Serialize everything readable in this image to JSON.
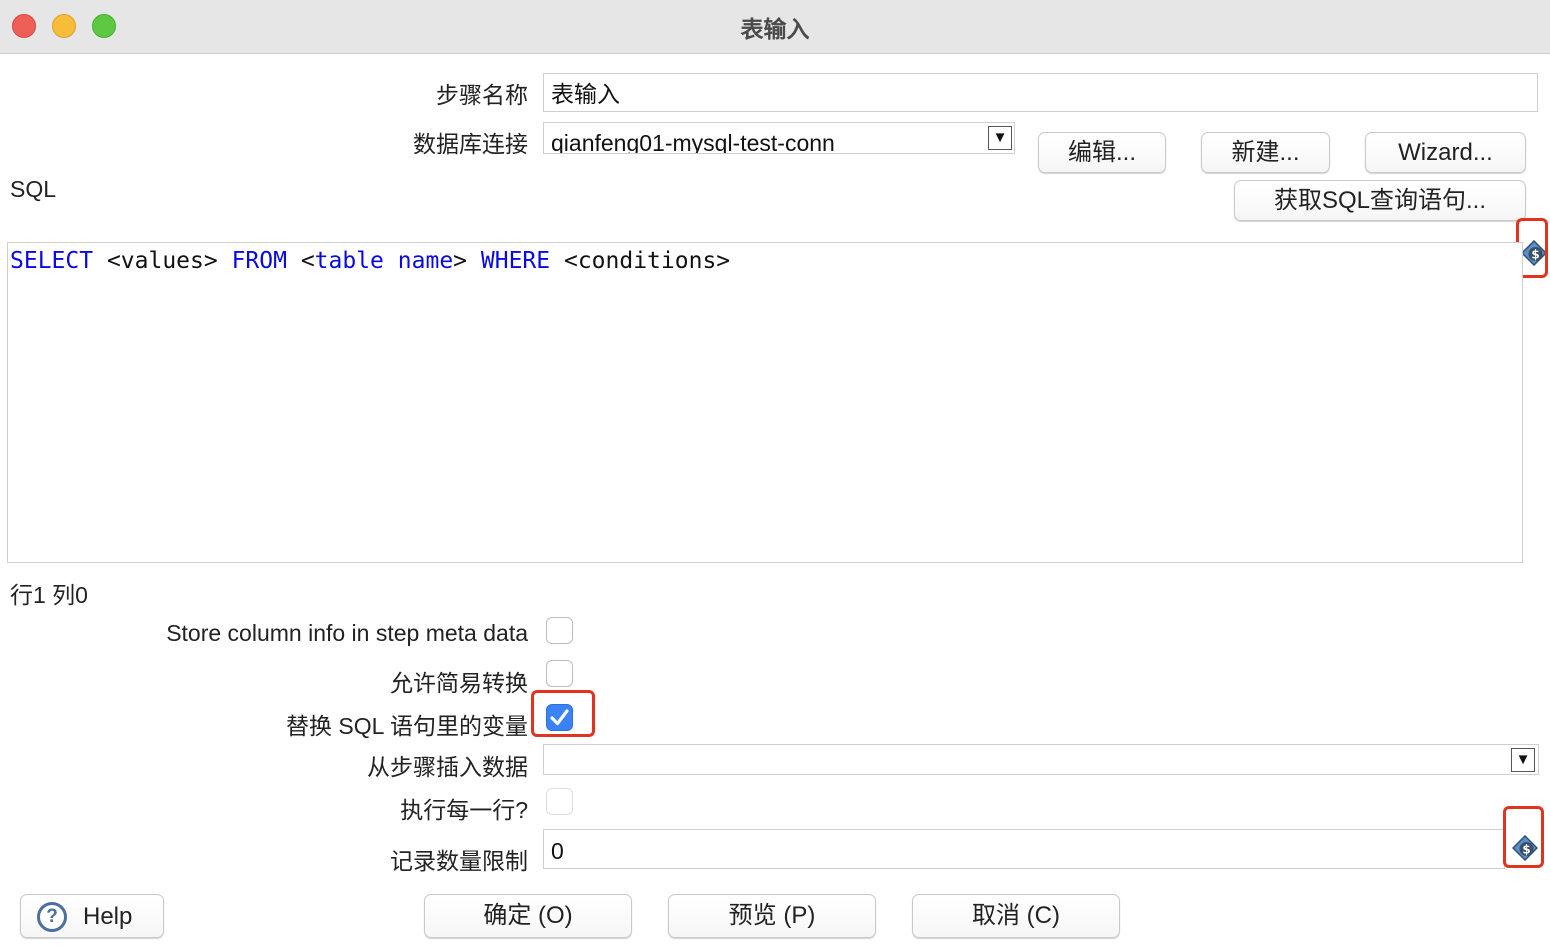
{
  "window": {
    "title": "表输入"
  },
  "form": {
    "step_name_label": "步骤名称",
    "step_name_value": "表输入",
    "connection_label": "数据库连接",
    "connection_value": "qianfeng01-mysql-test-conn",
    "edit_button": "编辑...",
    "new_button": "新建...",
    "wizard_button": "Wizard...",
    "sql_label": "SQL",
    "get_sql_button": "获取SQL查询语句..."
  },
  "sql_editor": {
    "tokens": [
      {
        "text": "SELECT",
        "keyword": true
      },
      {
        "text": " <values> ",
        "keyword": false
      },
      {
        "text": "FROM",
        "keyword": true
      },
      {
        "text": " <",
        "keyword": false
      },
      {
        "text": "table",
        "keyword": true
      },
      {
        "text": " ",
        "keyword": false
      },
      {
        "text": "name",
        "keyword": true
      },
      {
        "text": "> ",
        "keyword": false
      },
      {
        "text": "WHERE",
        "keyword": true
      },
      {
        "text": " <conditions>",
        "keyword": false
      }
    ],
    "cursor_position": "行1 列0",
    "keyword_color": "#0a0ae0"
  },
  "options": {
    "store_column_info_label": "Store column info in step meta data",
    "store_column_info_checked": false,
    "lazy_conversion_label": "允许简易转换",
    "lazy_conversion_checked": false,
    "replace_variables_label": "替换 SQL 语句里的变量",
    "replace_variables_checked": true,
    "insert_from_step_label": "从步骤插入数据",
    "insert_from_step_value": "",
    "execute_each_row_label": "执行每一行?",
    "execute_each_row_checked": false,
    "limit_label": "记录数量限制",
    "limit_value": "0"
  },
  "footer": {
    "help_button": "Help",
    "ok_button": "确定 (O)",
    "preview_button": "预览 (P)",
    "cancel_button": "取消 (C)"
  },
  "icons": {
    "variable_icon": "variable-dollar-icon",
    "dropdown_icon": "triangle-down-icon",
    "checkmark_icon": "checkmark-icon",
    "help_icon": "question-circle-icon"
  },
  "colors": {
    "highlight": "#e1341e",
    "checkbox_checked": "#3b82f6"
  }
}
